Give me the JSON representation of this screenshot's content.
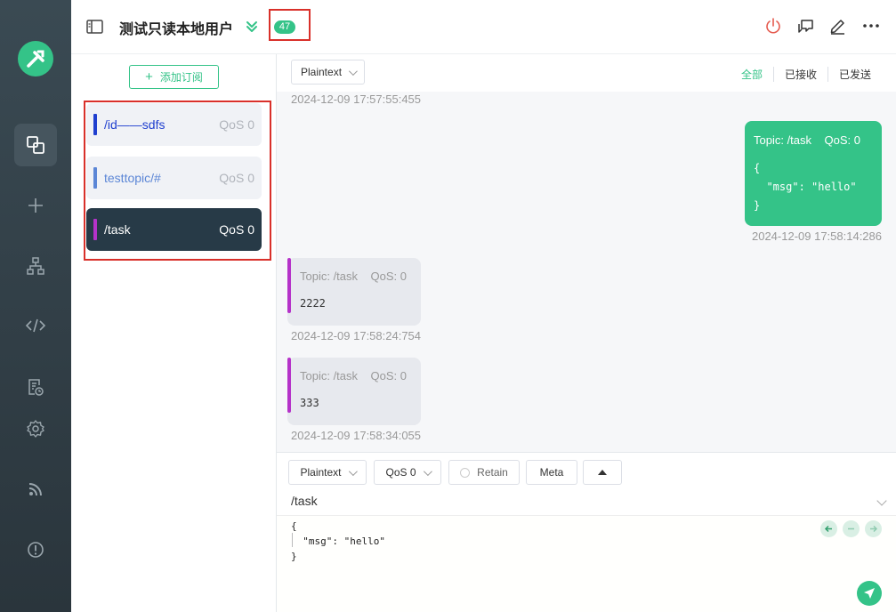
{
  "header": {
    "title": "测试只读本地用户",
    "message_count": "47"
  },
  "subscriptions": {
    "add_label": "添加订阅",
    "items": [
      {
        "topic": "/id——sdfs",
        "qos": "QoS 0",
        "color": "#1f3fcf"
      },
      {
        "topic": "testtopic/#",
        "qos": "QoS 0",
        "color": "#5b86d6"
      },
      {
        "topic": "/task",
        "qos": "QoS 0",
        "color": "#b532c9",
        "selected": true
      }
    ]
  },
  "message_toolbar": {
    "format": "Plaintext",
    "filters": [
      "全部",
      "已接收",
      "已发送"
    ]
  },
  "messages": [
    {
      "direction": "received",
      "time": "2024-12-09 17:57:55:455"
    },
    {
      "direction": "sent",
      "meta": "Topic: /task    QoS: 0",
      "payload": "{\n  \"msg\": \"hello\"\n}",
      "time": "2024-12-09 17:58:14:286"
    },
    {
      "direction": "received",
      "meta": "Topic: /task    QoS: 0",
      "payload": "2222",
      "time": "2024-12-09 17:58:24:754"
    },
    {
      "direction": "received",
      "meta": "Topic: /task    QoS: 0",
      "payload": "333",
      "time": "2024-12-09 17:58:34:055"
    }
  ],
  "composer": {
    "format": "Plaintext",
    "qos": "QoS 0",
    "retain_label": "Retain",
    "meta_label": "Meta",
    "topic": "/task",
    "payload": "{\n  \"msg\": \"hello\"\n}"
  },
  "colors": {
    "accent": "#34c388",
    "rail": "#2e3a41",
    "selected_sub": "#273a47",
    "highlight_box": "#d9302a"
  }
}
